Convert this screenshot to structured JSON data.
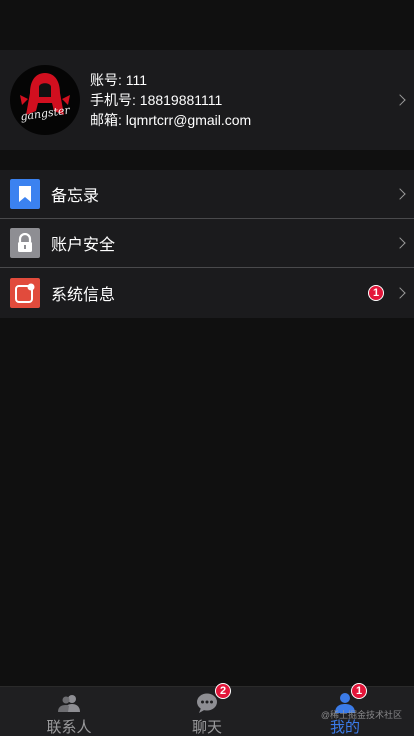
{
  "profile": {
    "avatar_text": "gangster",
    "account_label": "账号:",
    "account_value": "111",
    "phone_label": "手机号:",
    "phone_value": "18819881111",
    "email_label": "邮箱:",
    "email_value": "lqmrtcrr@gmail.com"
  },
  "menu": {
    "items": [
      {
        "label": "备忘录",
        "icon": "bookmark-icon",
        "color": "#3b82f0"
      },
      {
        "label": "账户安全",
        "icon": "lock-icon",
        "color": "#8e8e93"
      },
      {
        "label": "系统信息",
        "icon": "notification-icon",
        "color": "#e14b3c",
        "badge": "1"
      }
    ]
  },
  "tabbar": {
    "tabs": [
      {
        "label": "联系人",
        "icon": "contacts-icon"
      },
      {
        "label": "聊天",
        "icon": "chat-icon",
        "badge": "2"
      },
      {
        "label": "我的",
        "icon": "profile-icon",
        "badge": "1",
        "active": true
      }
    ]
  },
  "watermark": "@稀土掘金技术社区",
  "colors": {
    "background": "#101010",
    "panel": "#1b1b1d",
    "accent": "#3b7be8",
    "badge": "#e3163a"
  }
}
